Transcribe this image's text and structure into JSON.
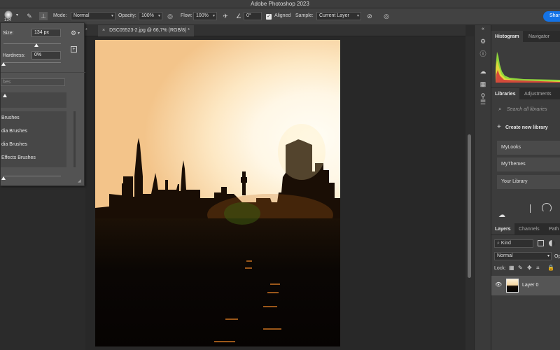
{
  "app": {
    "title": "Adobe Photoshop 2023"
  },
  "options_bar": {
    "brush_size_value": "134",
    "mode_label": "Mode:",
    "mode_value": "Normal",
    "opacity_label": "Opacity:",
    "opacity_value": "100%",
    "flow_label": "Flow:",
    "flow_value": "100%",
    "angle_value": "0°",
    "aligned_label": "Aligned",
    "aligned_checked": true,
    "sample_label": "Sample:",
    "sample_value": "Current Layer",
    "share_label": "Shar"
  },
  "document": {
    "tab_prev_partial": "*",
    "tab_label": "DSC05523-2.jpg @ 66,7% (RGB/8) *",
    "close_glyph": "×"
  },
  "brush_popup": {
    "size_label": "Size:",
    "size_value": "134 px",
    "hardness_label": "Hardness:",
    "hardness_value": "0%",
    "search_placeholder": "hes",
    "folders": [
      "Brushes",
      "dia Brushes",
      "dia Brushes",
      "Effects Brushes"
    ]
  },
  "panels": {
    "histogram_tabs": [
      "Histogram",
      "Navigator"
    ],
    "libraries_tabs": [
      "Libraries",
      "Adjustments"
    ],
    "library_search_placeholder": "Search all libraries",
    "create_library_label": "Create new library",
    "libraries": [
      "MyLooks",
      "MyThemes",
      "Your Library"
    ],
    "layers_tabs": [
      "Layers",
      "Channels",
      "Path"
    ],
    "kind_filter": "Kind",
    "blend_mode": "Normal",
    "opacity_partial": "Op",
    "lock_label": "Lock:",
    "layer_name": "Layer 0"
  },
  "icons": [
    "brush-preset-icon",
    "settings-icon",
    "airbrush-icon",
    "angle-icon",
    "ignore-adjustment-icon",
    "pressure-icon",
    "eye-icon",
    "gear-icon"
  ]
}
